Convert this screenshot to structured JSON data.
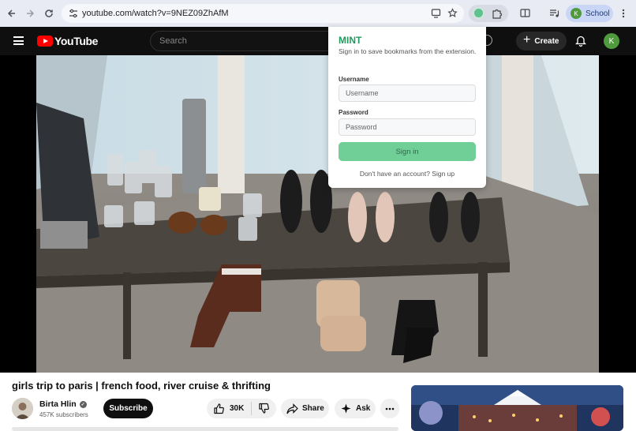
{
  "browser": {
    "url": "youtube.com/watch?v=9NEZ09ZhAfM",
    "profile_initial": "K",
    "profile_name": "School"
  },
  "youtube": {
    "logo_text": "YouTube",
    "search_placeholder": "Search",
    "create_label": "Create",
    "avatar_initial": "K"
  },
  "popup": {
    "title": "MINT",
    "subtitle": "Sign in to save bookmarks from the extension.",
    "username_label": "Username",
    "username_placeholder": "Username",
    "password_label": "Password",
    "password_placeholder": "Password",
    "signin_label": "Sign in",
    "signup_text": "Don't have an account? Sign up"
  },
  "video": {
    "title": "girls trip to paris | french food, river cruise & thrifting",
    "channel_name": "Birta Hlin",
    "subscribers": "457K subscribers",
    "subscribe_label": "Subscribe",
    "likes": "30K",
    "share_label": "Share",
    "ask_label": "Ask"
  },
  "colors": {
    "mint_accent": "#1e9a5c",
    "signin_button": "#6fcf97",
    "youtube_red": "#ff0000",
    "profile_green": "#4f9a3c"
  },
  "icons": [
    "back-arrow-icon",
    "forward-arrow-icon",
    "reload-icon",
    "tune-icon",
    "cast-icon",
    "star-icon",
    "extension-icon",
    "puzzle-icon",
    "split-view-icon",
    "media-icon",
    "more-vertical-icon",
    "hamburger-icon",
    "microphone-icon",
    "plus-icon",
    "bell-icon",
    "verified-icon",
    "thumbs-up-icon",
    "thumbs-down-icon",
    "share-icon",
    "sparkle-icon",
    "more-horizontal-icon"
  ]
}
